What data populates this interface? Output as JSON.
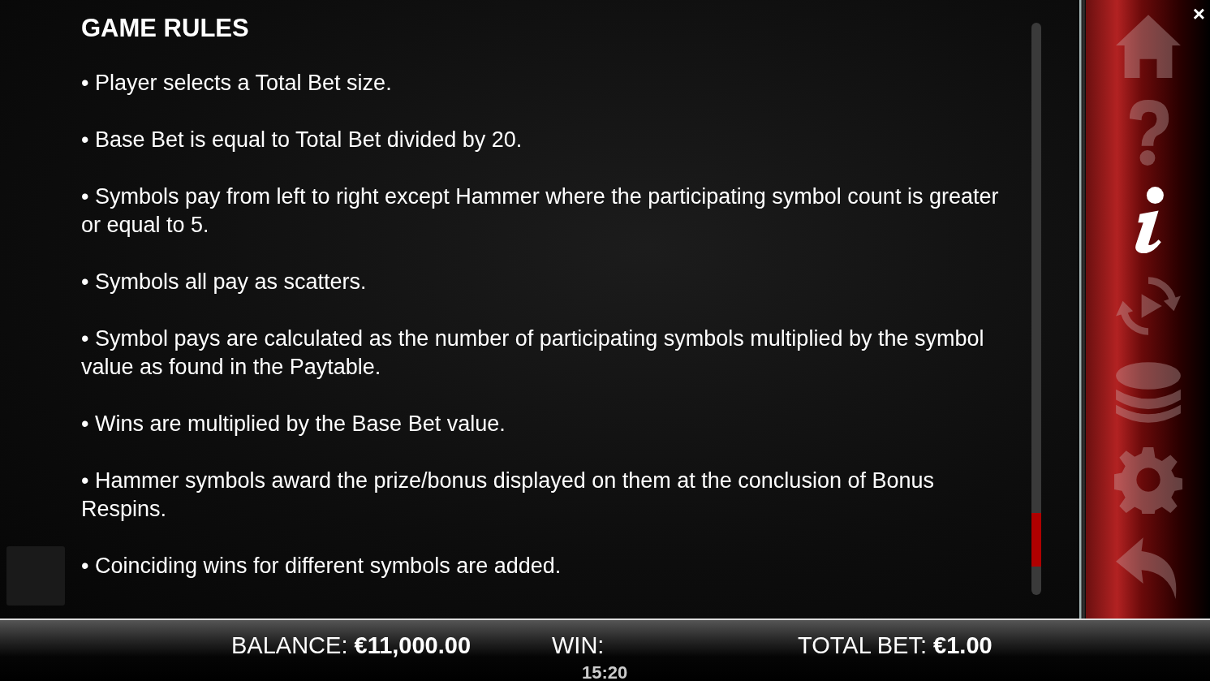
{
  "rules": {
    "title": "GAME RULES",
    "items": [
      "• Player selects a Total Bet size.",
      "• Base Bet is equal to Total Bet divided by 20.",
      "• Symbols pay from left to right except Hammer where the participating symbol count is greater or equal to 5.",
      "• Symbols all pay as scatters.",
      "• Symbol pays are calculated as the number of participating symbols multiplied by the symbol value as found in the Paytable.",
      "• Wins are multiplied by the Base Bet value.",
      "• Hammer symbols award the prize/bonus displayed on them at the conclusion of Bonus Respins.",
      "• Coinciding wins for different symbols are added."
    ]
  },
  "close": "×",
  "menu": [
    {
      "kind": "home",
      "selected": false
    },
    {
      "kind": "help",
      "selected": false
    },
    {
      "kind": "info",
      "selected": true
    },
    {
      "kind": "autoplay",
      "selected": false
    },
    {
      "kind": "coins",
      "selected": false
    },
    {
      "kind": "settings",
      "selected": false
    },
    {
      "kind": "back",
      "selected": false
    }
  ],
  "status_bar": {
    "balance_label": "BALANCE:",
    "balance": "€11,000.00",
    "win_label": "WIN:",
    "total_bet_label": "TOTAL BET:",
    "total_bet": "€1.00",
    "clock": "15:20"
  }
}
